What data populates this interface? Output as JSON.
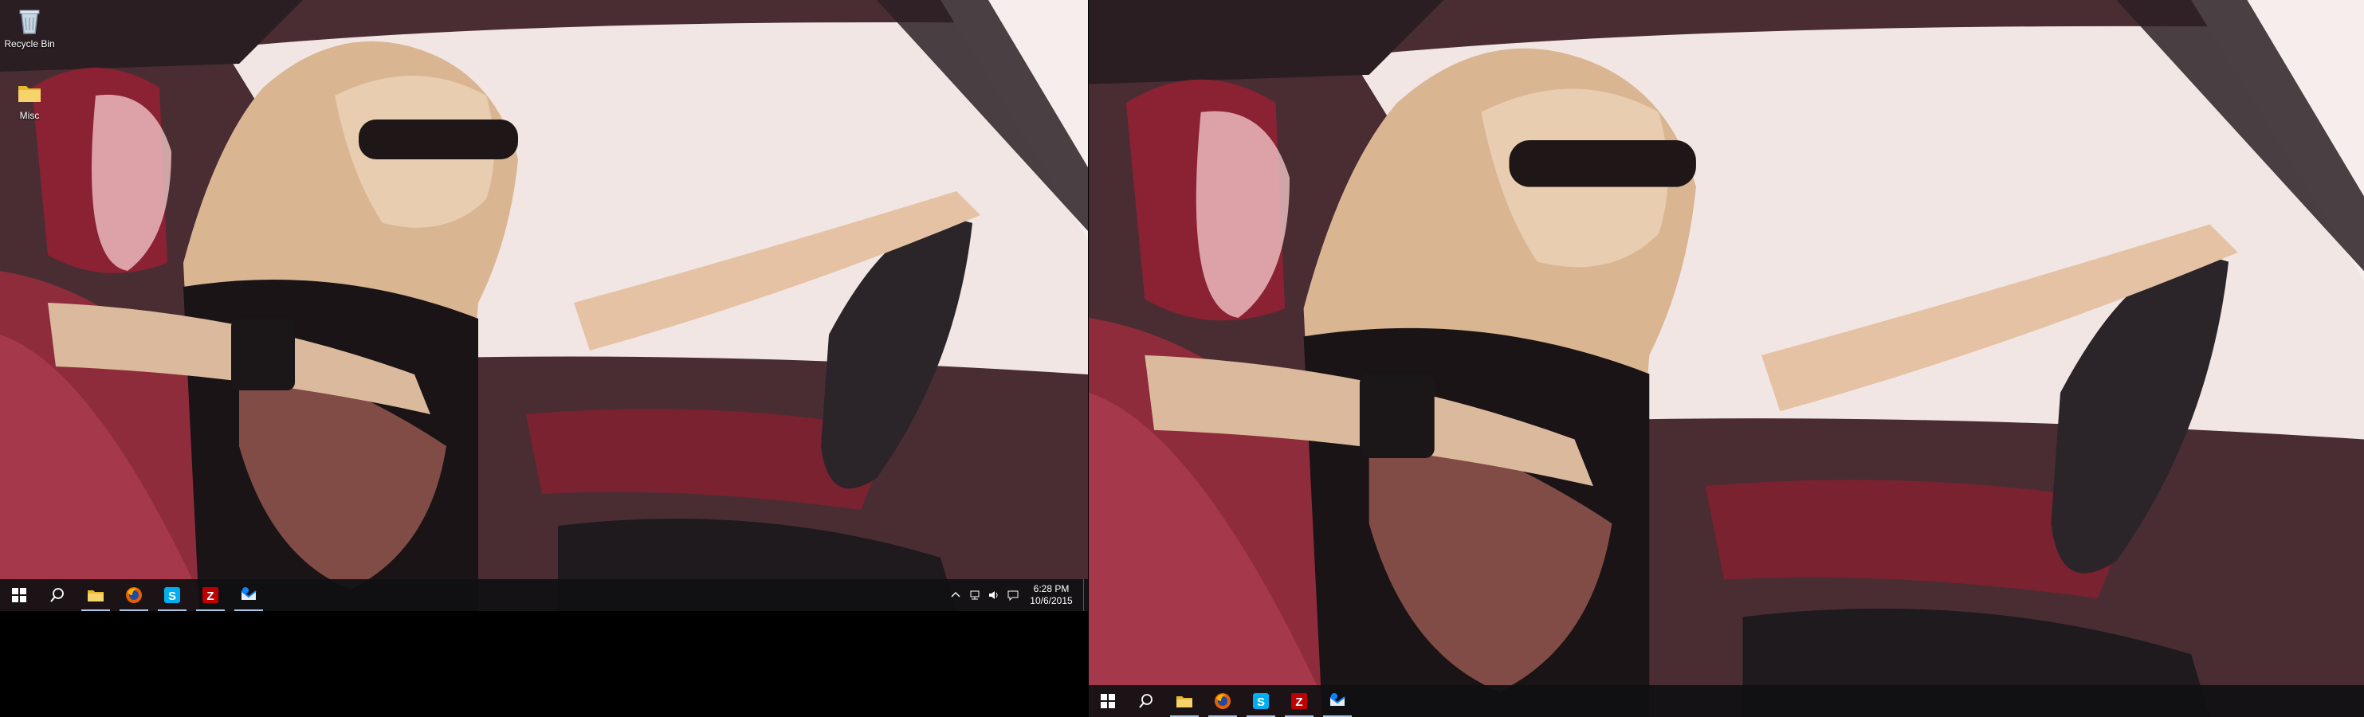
{
  "desktop": {
    "icons": [
      {
        "label": "Recycle Bin",
        "icon": "recycle-bin-icon"
      },
      {
        "label": "Misc",
        "icon": "folder-icon"
      }
    ]
  },
  "taskbar_left": {
    "apps": [
      {
        "name": "File Explorer",
        "icon": "folder-icon",
        "color": "#e8b92d"
      },
      {
        "name": "Firefox",
        "icon": "firefox-icon",
        "color": "#e66000"
      },
      {
        "name": "Skype",
        "icon": "skype-icon",
        "color": "#00aff0"
      },
      {
        "name": "FileZilla",
        "icon": "filezilla-icon",
        "color": "#bf0000"
      },
      {
        "name": "Thunderbird",
        "icon": "thunderbird-icon",
        "color": "#0a84ff"
      }
    ],
    "tray": {
      "time": "6:28 PM",
      "date": "10/6/2015"
    }
  },
  "taskbar_right": {
    "apps": [
      {
        "name": "File Explorer",
        "icon": "folder-icon"
      },
      {
        "name": "Firefox",
        "icon": "firefox-icon"
      },
      {
        "name": "Skype",
        "icon": "skype-icon"
      },
      {
        "name": "FileZilla",
        "icon": "filezilla-icon"
      },
      {
        "name": "Thunderbird",
        "icon": "thunderbird-icon"
      }
    ]
  },
  "colors": {
    "taskbar": "#101012",
    "accent_underline": "#a9c8e8",
    "windows_logo": "#ffffff"
  }
}
